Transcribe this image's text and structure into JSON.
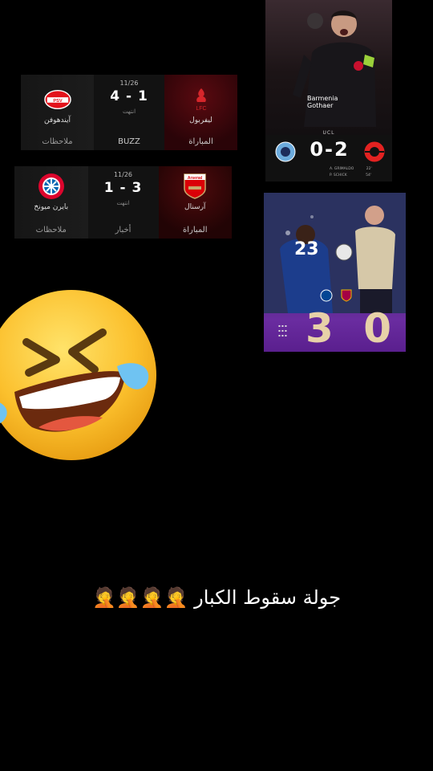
{
  "matches": [
    {
      "date": "11/26",
      "score": "4 - 1",
      "status": "انتهت",
      "away_team": "آيندهوفن",
      "home_team": "ليفربول",
      "footer_away": "ملاحظات",
      "footer_mid": "BUZZ",
      "footer_home": "المباراة",
      "away_crest": "psv-crest-icon",
      "home_crest": "liverpool-crest-icon"
    },
    {
      "date": "11/26",
      "score": "1 - 3",
      "status": "انتهت",
      "away_team": "بايرن ميونخ",
      "home_team": "آرسنال",
      "footer_away": "ملاحظات",
      "footer_mid": "أخبار",
      "footer_home": "المباراة",
      "away_crest": "bayern-crest-icon",
      "home_crest": "arsenal-crest-icon"
    }
  ],
  "ucl_card": {
    "competition": "UCL",
    "score": "0-2",
    "sponsor_line1": "Barmenia",
    "sponsor_line2": "Gothaer",
    "scorer1": "A. GRIMALDO",
    "scorer1_min": "22'",
    "scorer2": "P. SCHICK",
    "scorer2_min": "54'"
  },
  "chelsea_card": {
    "score": "3 0",
    "shirt_number": "23"
  },
  "caption": "جولة سقوط الكبار 🤦🤦🤦🤦"
}
